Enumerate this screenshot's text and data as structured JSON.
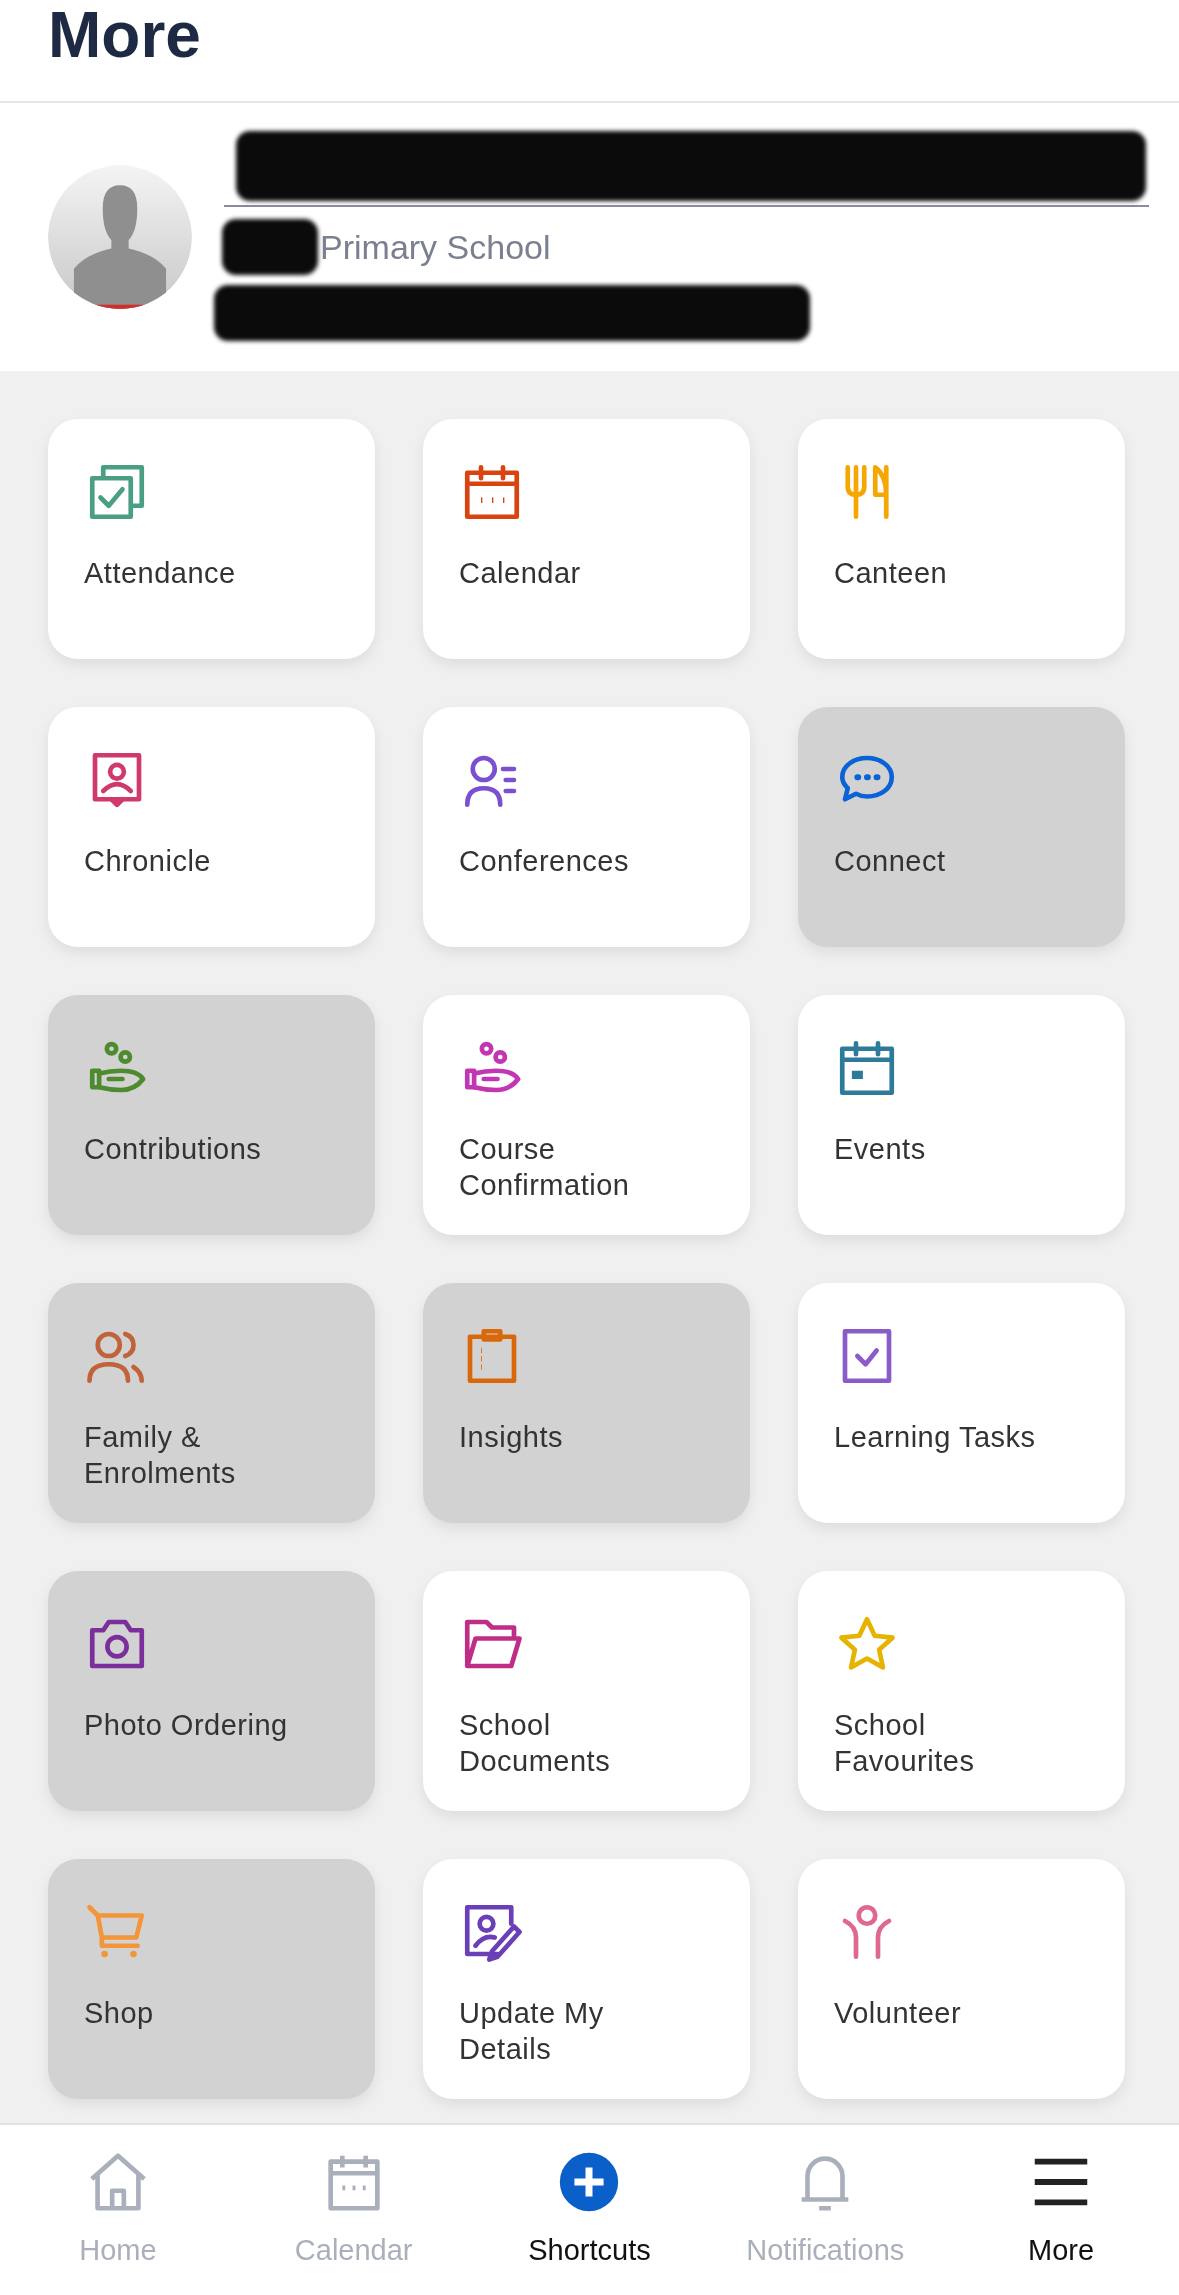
{
  "header": {
    "title": "More"
  },
  "profile": {
    "school": "Primary School"
  },
  "tiles": [
    {
      "label": "Attendance",
      "disabled": false,
      "color": "#4a9e84"
    },
    {
      "label": "Calendar",
      "disabled": false,
      "color": "#d9430f"
    },
    {
      "label": "Canteen",
      "disabled": false,
      "color": "#f5a600"
    },
    {
      "label": "Chronicle",
      "disabled": false,
      "color": "#d03a6a"
    },
    {
      "label": "Conferences",
      "disabled": false,
      "color": "#7a4fd0"
    },
    {
      "label": "Connect",
      "disabled": true,
      "color": "#0a63d6"
    },
    {
      "label": "Contributions",
      "disabled": true,
      "color": "#4e8a2e"
    },
    {
      "label": "Course Confirmation",
      "disabled": false,
      "color": "#c236b4"
    },
    {
      "label": "Events",
      "disabled": false,
      "color": "#2e7a99"
    },
    {
      "label": "Family & Enrolments",
      "disabled": true,
      "color": "#c0623a"
    },
    {
      "label": "Insights",
      "disabled": true,
      "color": "#d9680a"
    },
    {
      "label": "Learning Tasks",
      "disabled": false,
      "color": "#8a5cc8"
    },
    {
      "label": "Photo Ordering",
      "disabled": true,
      "color": "#7a2f9a"
    },
    {
      "label": "School Documents",
      "disabled": false,
      "color": "#c02d86"
    },
    {
      "label": "School Favourites",
      "disabled": false,
      "color": "#e6b400"
    },
    {
      "label": "Shop",
      "disabled": true,
      "color": "#f4953a"
    },
    {
      "label": "Update My Details",
      "disabled": false,
      "color": "#6a3fb8"
    },
    {
      "label": "Volunteer",
      "disabled": false,
      "color": "#e0688e"
    }
  ],
  "tab_bar": [
    {
      "label": "Home",
      "kind": "tab",
      "selected": false
    },
    {
      "label": "Calendar",
      "kind": "tab",
      "selected": false
    },
    {
      "label": "Shortcuts",
      "kind": "action"
    },
    {
      "label": "Notifications",
      "kind": "tab",
      "selected": false
    },
    {
      "label": "More",
      "kind": "tab",
      "selected": true
    }
  ]
}
